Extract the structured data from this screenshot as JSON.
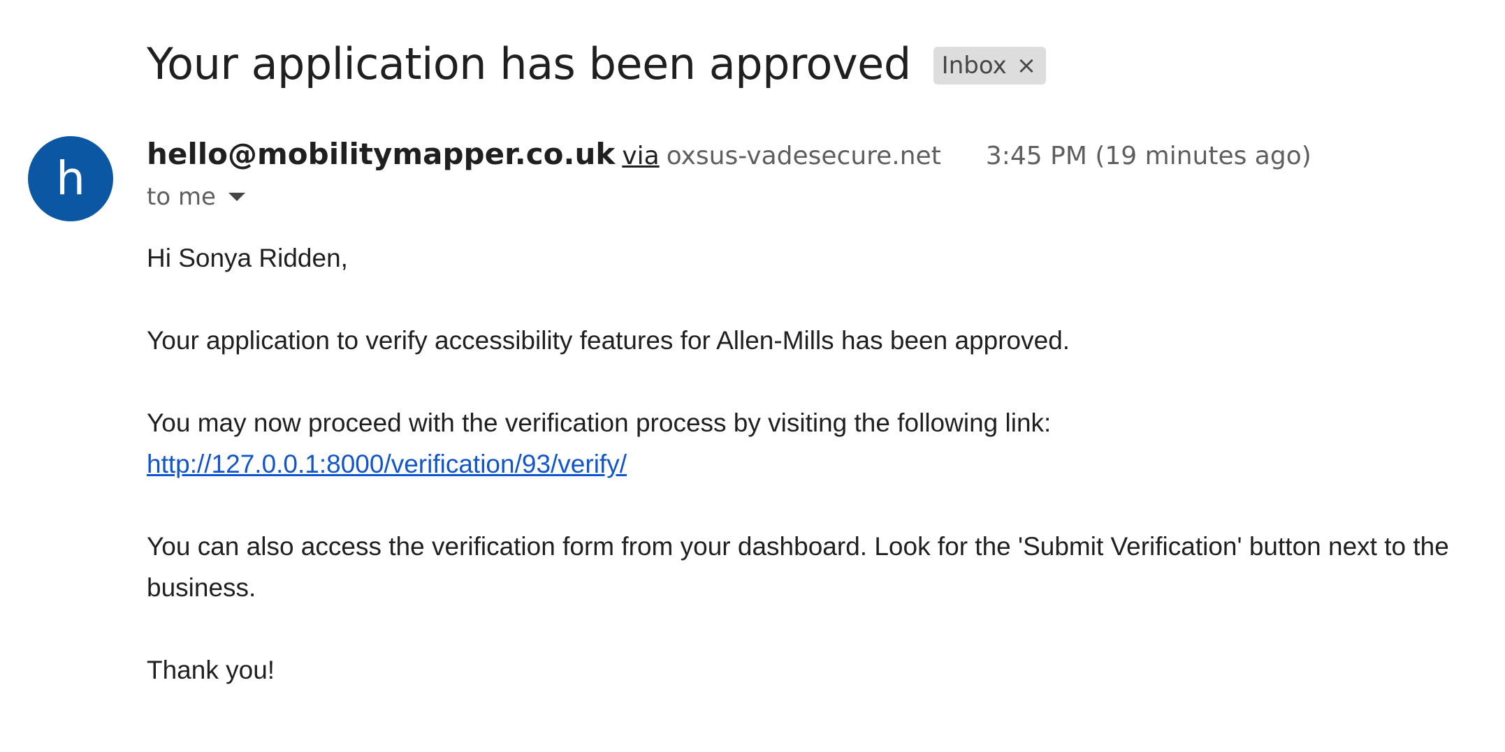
{
  "subject": "Your application has been approved",
  "label": {
    "name": "Inbox",
    "close_glyph": "×"
  },
  "avatar": {
    "letter": "h",
    "color": "#0b57a4"
  },
  "sender": {
    "email": "hello@mobilitymapper.co.uk",
    "via_label": "via",
    "via_domain": "oxsus-vadesecure.net",
    "timestamp": "3:45 PM (19 minutes ago)"
  },
  "recipient": {
    "label": "to me",
    "caret_icon": "caret-down-icon"
  },
  "body": {
    "greeting": "Hi Sonya Ridden,",
    "paragraph_1": "Your application to verify accessibility features for Allen-Mills has been approved.",
    "paragraph_2_text": "You may now proceed with the verification process by visiting the following link:",
    "verification_link": "http://127.0.0.1:8000/verification/93/verify/",
    "paragraph_3": "You can also access the verification form from your dashboard. Look for the 'Submit Verification' button next to the business.",
    "closing": "Thank you!"
  },
  "colors": {
    "link": "#1155cc",
    "label_chip_bg": "#dddddd"
  }
}
